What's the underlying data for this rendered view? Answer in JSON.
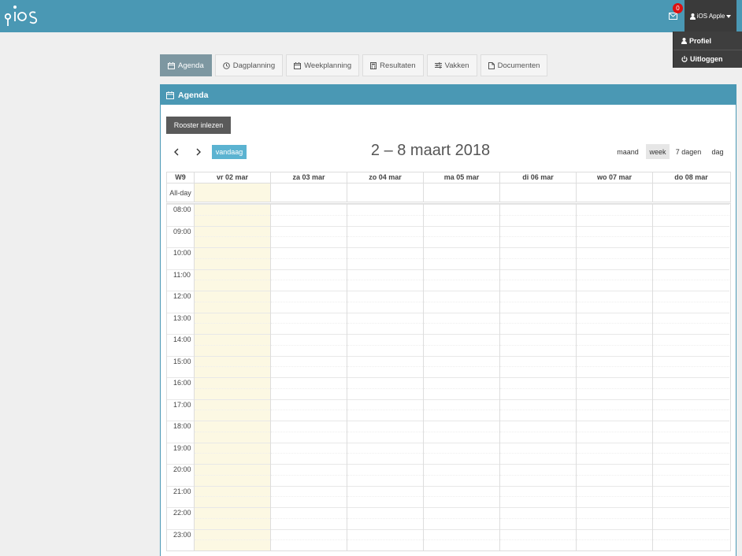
{
  "header": {
    "logo_text": "pios",
    "mail_count": "0",
    "user_name": "iOS Apple",
    "user_menu": [
      "Profiel",
      "Uitloggen"
    ]
  },
  "tabs": [
    {
      "label": "Agenda",
      "icon": "calendar-icon",
      "active": true
    },
    {
      "label": "Dagplanning",
      "icon": "clock-icon",
      "active": false
    },
    {
      "label": "Weekplanning",
      "icon": "calendar-icon",
      "active": false
    },
    {
      "label": "Resultaten",
      "icon": "calculator-icon",
      "active": false
    },
    {
      "label": "Vakken",
      "icon": "sliders-icon",
      "active": false
    },
    {
      "label": "Documenten",
      "icon": "file-icon",
      "active": false
    }
  ],
  "panel": {
    "title": "Agenda",
    "import_button": "Rooster inlezen",
    "today_button": "vandaag",
    "range_title": "2 – 8 maart 2018",
    "views": [
      "maand",
      "week",
      "7 dagen",
      "dag"
    ],
    "active_view": "week"
  },
  "calendar": {
    "week_label": "W9",
    "allday_label": "All-day",
    "days": [
      "vr 02 mar",
      "za 03 mar",
      "zo 04 mar",
      "ma 05 mar",
      "di 06 mar",
      "wo 07 mar",
      "do 08 mar"
    ],
    "today_index": 0,
    "hours": [
      "08:00",
      "09:00",
      "10:00",
      "11:00",
      "12:00",
      "13:00",
      "14:00",
      "15:00",
      "16:00",
      "17:00",
      "18:00",
      "19:00",
      "20:00",
      "21:00",
      "22:00",
      "23:00"
    ]
  },
  "colors": {
    "brand": "#4a98b4",
    "active_tab": "#7d97a1",
    "today_bg": "#fcf8e3",
    "today_button": "#5bb3d1"
  }
}
